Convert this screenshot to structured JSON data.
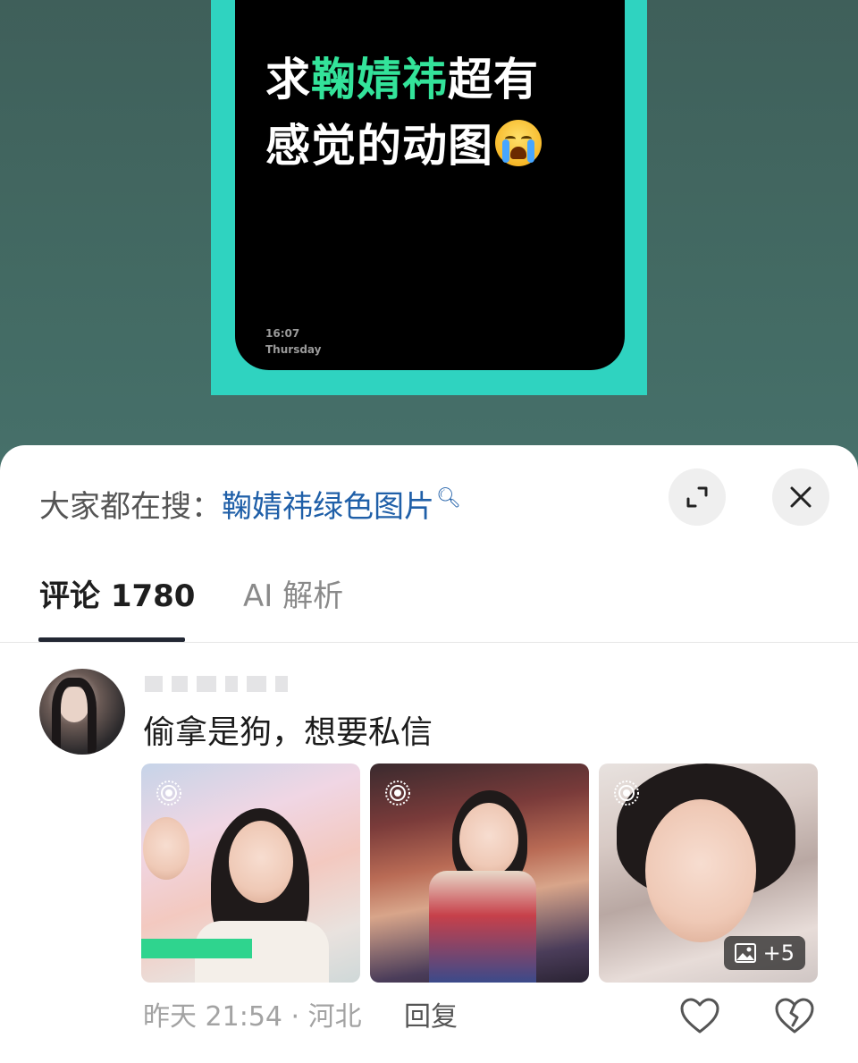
{
  "poster": {
    "title_prefix": "求",
    "title_highlight": "鞠婧祎",
    "title_line1_suffix": "超有",
    "title_line2": "感觉的动图",
    "emoji": "loudly-crying-face-icon",
    "time": "16:07",
    "day": "Thursday",
    "colors": {
      "frame": "#2fd3c0",
      "highlight": "#33e39a"
    }
  },
  "search": {
    "prefix": "大家都在搜：",
    "keyword": "鞠婧祎绿色图片"
  },
  "tabs": [
    {
      "label": "评论 1780",
      "active": true
    },
    {
      "label": "AI 解析",
      "active": false
    }
  ],
  "comment": {
    "text": "偷拿是狗，想要私信",
    "images_more": "+5",
    "date": "昨天 21:54",
    "separator": "·",
    "location": "河北",
    "reply_label": "回复"
  }
}
